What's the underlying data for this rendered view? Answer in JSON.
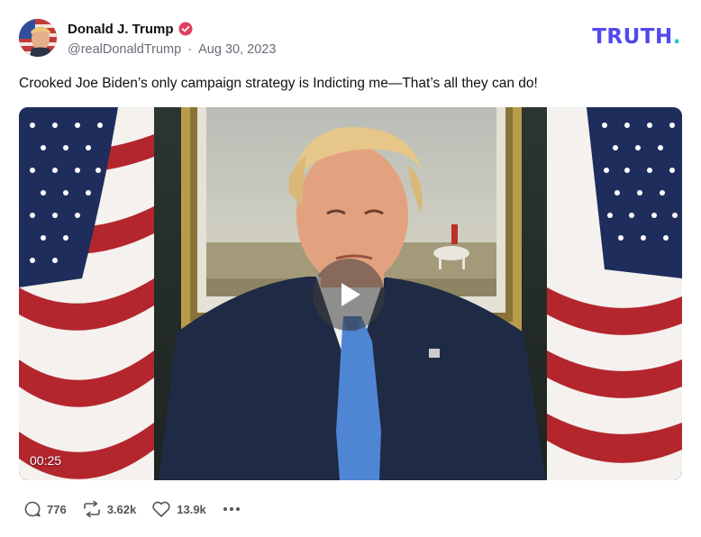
{
  "header": {
    "display_name": "Donald J. Trump",
    "handle": "@realDonaldTrump",
    "separator": "·",
    "date": "Aug 30, 2023",
    "brand_main": "TRUTH",
    "brand_dot": ".",
    "verified_icon": "verified-badge-icon",
    "colors": {
      "brand": "#5448ee",
      "brand_dot": "#1cc6d8",
      "verified": "#e0405f"
    }
  },
  "post": {
    "text": "Crooked Joe Biden’s only campaign strategy is Indicting me—That’s all they can do!"
  },
  "media": {
    "duration": "00:25",
    "play_icon": "play-icon"
  },
  "actions": {
    "replies": "776",
    "retruths": "3.62k",
    "likes": "13.9k",
    "icons": [
      "reply-icon",
      "retruth-icon",
      "like-icon",
      "more-icon"
    ]
  }
}
